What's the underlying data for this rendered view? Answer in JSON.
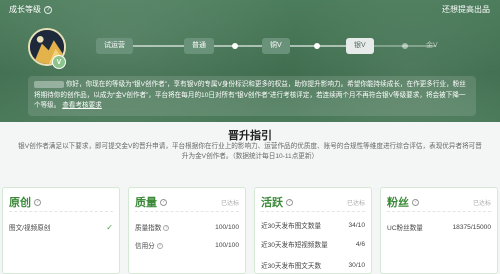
{
  "header": {
    "title": "成长等级",
    "link": "还想提高出品"
  },
  "avatar": {
    "badge": "V"
  },
  "levels": [
    {
      "label": "试运营"
    },
    {
      "label": "普通"
    },
    {
      "label": "铜V"
    },
    {
      "label": "银V"
    },
    {
      "label": "金V"
    }
  ],
  "notice": {
    "greeting": "你好，你现在的等级为“银V创作者”，享有银V的专属V身份标识和更多的权益，助你提升影响力。希望你能持续成长，在作更多行业，粉丝将期待你的创作品，以成为“金V创作者”，平台将在每月的10日对所有“银V创作者”进行考核评定，若连续两个月不再符合银V等级要求，将会被下降一个等级。",
    "link": "查看考核要求"
  },
  "guide": {
    "title": "晋升指引",
    "desc": "银V创作者满足以下要求，即可提交金V的晋升申请，平台根据你在行业上的影响力、运营作品的优质度、账号的合规性等维度进行综合评估，表现优异者将可晋升为金V创作者。（数据统计每日10-11点更新）"
  },
  "cards": [
    {
      "name": "原创",
      "status": "",
      "rows": [
        {
          "label": "图文/视频原创",
          "value": "",
          "check": "✓"
        }
      ]
    },
    {
      "name": "质量",
      "status": "已达标",
      "rows": [
        {
          "label": "质量指数",
          "value": "100/100"
        },
        {
          "label": "信用分",
          "value": "100/100"
        }
      ]
    },
    {
      "name": "活跃",
      "status": "已达标",
      "rows": [
        {
          "label": "近30天发布图文数量",
          "value": "34/10"
        },
        {
          "label": "近30天发布短视频数量",
          "value": "4/6"
        },
        {
          "label": "近30天发布图文天数",
          "value": "30/10"
        }
      ]
    },
    {
      "name": "粉丝",
      "status": "已达标",
      "rows": [
        {
          "label": "UC粉丝数量",
          "value": "18375/15000"
        }
      ]
    }
  ]
}
